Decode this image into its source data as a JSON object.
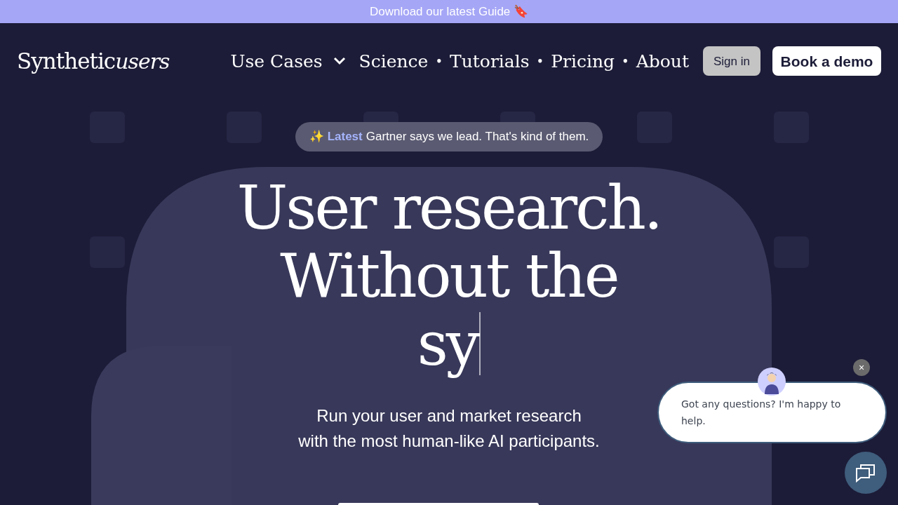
{
  "banner": {
    "text": "Download our latest Guide 🔖"
  },
  "logo": {
    "word": "Synthetic",
    "script": "users"
  },
  "nav": [
    {
      "label": "Use Cases",
      "kind": "dropdown"
    },
    {
      "label": "Science",
      "kind": "link"
    },
    {
      "label": "•",
      "kind": "separator"
    },
    {
      "label": "Tutorials",
      "kind": "link"
    },
    {
      "label": "•",
      "kind": "separator"
    },
    {
      "label": "Pricing",
      "kind": "link"
    },
    {
      "label": "•",
      "kind": "separator"
    },
    {
      "label": "About",
      "kind": "link"
    }
  ],
  "sign_in": "Sign in",
  "book_demo": "Book a demo",
  "announcement": {
    "icon": "✨",
    "tag": "Latest",
    "text": "Gartner says we lead. That's kind of them."
  },
  "headline": [
    "User research.",
    "Without the",
    "sy"
  ],
  "subtitle": [
    "Run your user and market research",
    "with the most human-like AI participants."
  ],
  "chat": {
    "message": "Got any questions? I'm happy to help.",
    "close": "×"
  }
}
